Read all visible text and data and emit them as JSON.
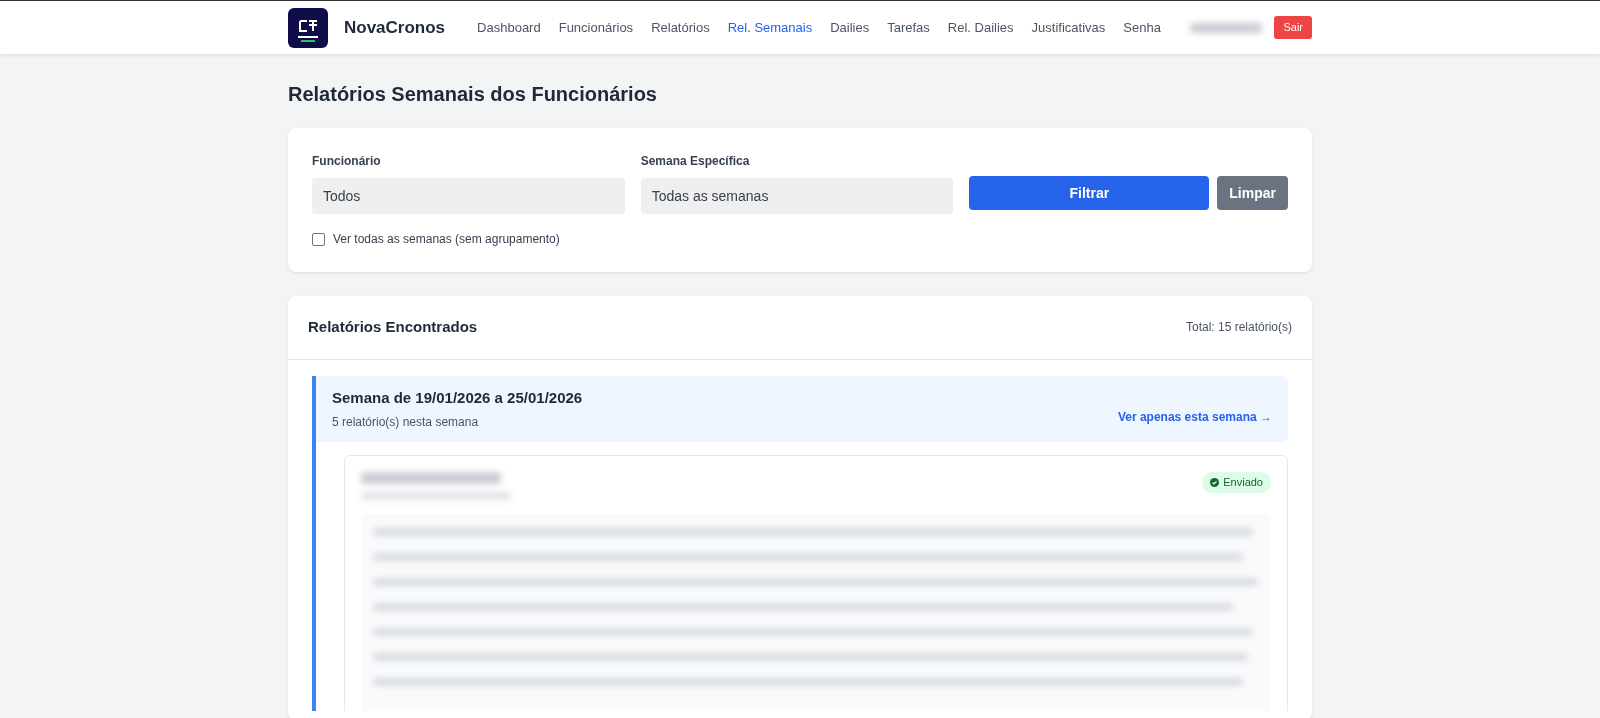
{
  "navbar": {
    "brand": "NovaCronos",
    "links": [
      {
        "label": "Dashboard",
        "selected": false
      },
      {
        "label": "Funcionários",
        "selected": false
      },
      {
        "label": "Relatórios",
        "selected": false
      },
      {
        "label": "Rel. Semanais",
        "selected": true
      },
      {
        "label": "Dailies",
        "selected": false
      },
      {
        "label": "Tarefas",
        "selected": false
      },
      {
        "label": "Rel. Dailies",
        "selected": false
      },
      {
        "label": "Justificativas",
        "selected": false
      },
      {
        "label": "Senha",
        "selected": false
      }
    ],
    "logout": "Sair"
  },
  "page_title": "Relatórios Semanais dos Funcionários",
  "filters": {
    "fields": [
      {
        "label": "Funcionário",
        "value": "Todos"
      },
      {
        "label": "Semana Específica",
        "value": "Todas as semanas"
      }
    ],
    "filter_button": "Filtrar",
    "clear_button": "Limpar",
    "checkbox": {
      "label": "Ver todas as semanas (sem agrupamento)",
      "checked": false
    }
  },
  "results": {
    "title": "Relatórios Encontrados",
    "total": "Total: 15 relatório(s)",
    "weeks": [
      {
        "title": "Semana de 19/01/2026 a 25/01/2026",
        "count": "5 relatório(s) nesta semana",
        "link": "Ver apenas esta semana →",
        "reports": [
          {
            "status": "Enviado"
          }
        ]
      }
    ]
  }
}
